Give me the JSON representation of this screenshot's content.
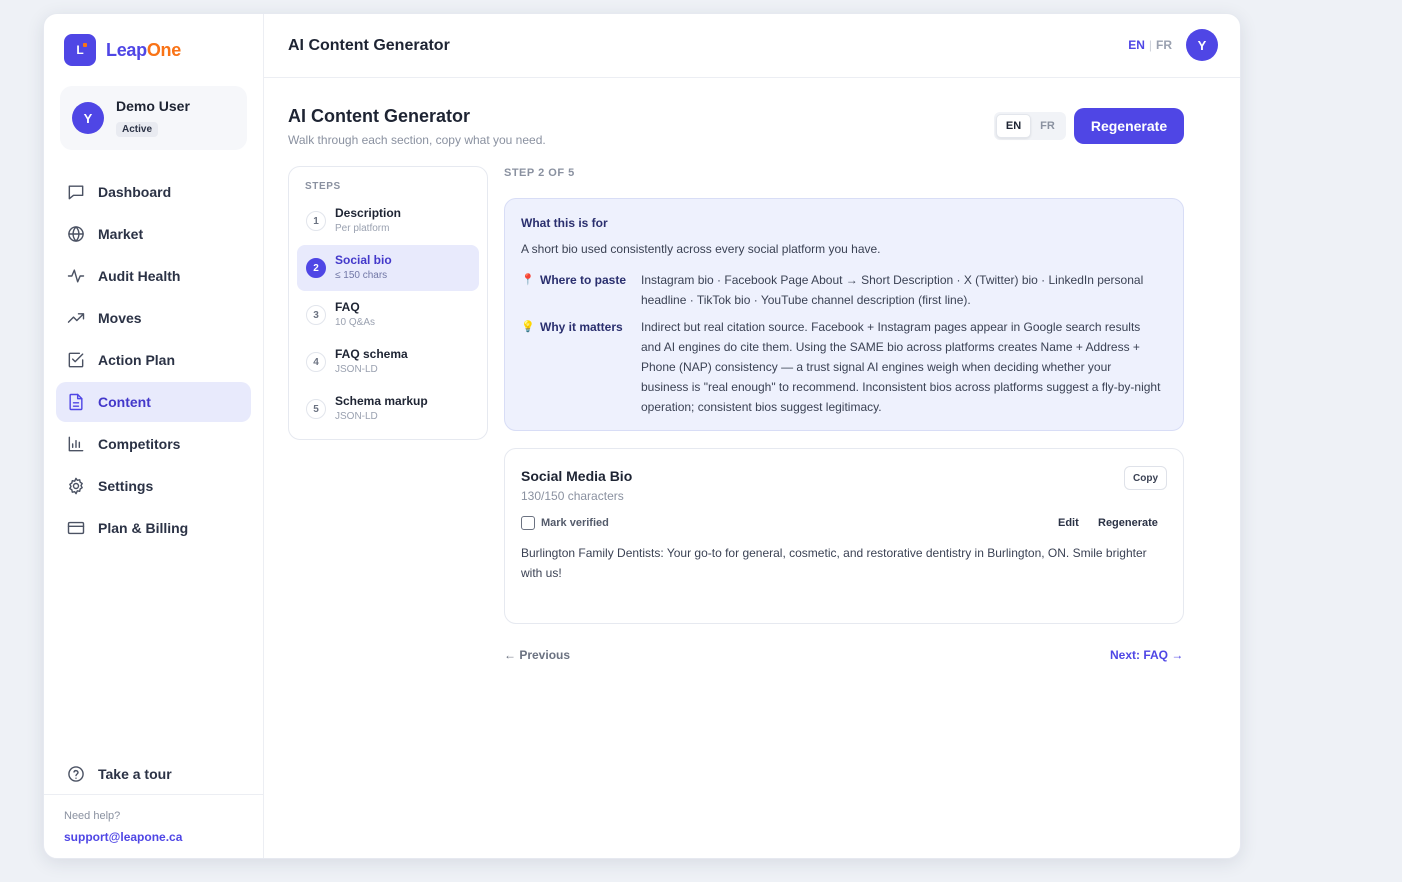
{
  "brand": {
    "mark": "L",
    "name_part1": "Leap",
    "name_part2": "One"
  },
  "user": {
    "avatar": "Y",
    "name": "Demo User",
    "status": "Active"
  },
  "nav": [
    {
      "label": "Dashboard",
      "icon": "chat-icon"
    },
    {
      "label": "Market",
      "icon": "globe-icon"
    },
    {
      "label": "Audit Health",
      "icon": "pulse-icon"
    },
    {
      "label": "Moves",
      "icon": "trend-up-icon"
    },
    {
      "label": "Action Plan",
      "icon": "checkbox-icon"
    },
    {
      "label": "Content",
      "icon": "document-icon",
      "active": true
    },
    {
      "label": "Competitors",
      "icon": "bar-chart-icon"
    },
    {
      "label": "Settings",
      "icon": "gear-icon"
    },
    {
      "label": "Plan & Billing",
      "icon": "credit-card-icon"
    }
  ],
  "tour": {
    "label": "Take a tour",
    "icon": "help-circle-icon"
  },
  "help": {
    "label": "Need help?",
    "email": "support@leapone.ca"
  },
  "topbar": {
    "title": "AI Content Generator",
    "lang_en": "EN",
    "lang_sep": "|",
    "lang_fr": "FR",
    "avatar": "Y"
  },
  "page": {
    "title": "AI Content Generator",
    "subtitle": "Walk through each section, copy what you need.",
    "lang_en": "EN",
    "lang_fr": "FR",
    "regenerate": "Regenerate"
  },
  "steps": {
    "label": "STEPS",
    "items": [
      {
        "num": "1",
        "name": "Description",
        "meta": "Per platform"
      },
      {
        "num": "2",
        "name": "Social bio",
        "meta": "≤ 150 chars",
        "active": true
      },
      {
        "num": "3",
        "name": "FAQ",
        "meta": "10 Q&As"
      },
      {
        "num": "4",
        "name": "FAQ schema",
        "meta": "JSON-LD"
      },
      {
        "num": "5",
        "name": "Schema markup",
        "meta": "JSON-LD"
      }
    ]
  },
  "step_indicator": "STEP 2 OF 5",
  "info": {
    "title": "What this is for",
    "lead": "A short bio used consistently across every social platform you have.",
    "where_label": "Where to paste",
    "where_text": "Instagram bio · Facebook Page About → Short Description · X (Twitter) bio · LinkedIn personal headline · TikTok bio · YouTube channel description (first line).",
    "why_label": "Why it matters",
    "why_text": "Indirect but real citation source. Facebook + Instagram pages appear in Google search results and AI engines do cite them. Using the SAME bio across platforms creates Name + Address + Phone (NAP) consistency — a trust signal AI engines weigh when deciding whether your business is \"real enough\" to recommend. Inconsistent bios across platforms suggest a fly-by-night operation; consistent bios suggest legitimacy."
  },
  "bio": {
    "title": "Social Media Bio",
    "count": "130/150 characters",
    "copy": "Copy",
    "verify": "Mark verified",
    "edit": "Edit",
    "regenerate": "Regenerate",
    "text": "Burlington Family Dentists: Your go-to for general, cosmetic, and restorative dentistry in Burlington, ON. Smile brighter with us!"
  },
  "footer_nav": {
    "previous": "← Previous",
    "next": "Next: FAQ →"
  }
}
